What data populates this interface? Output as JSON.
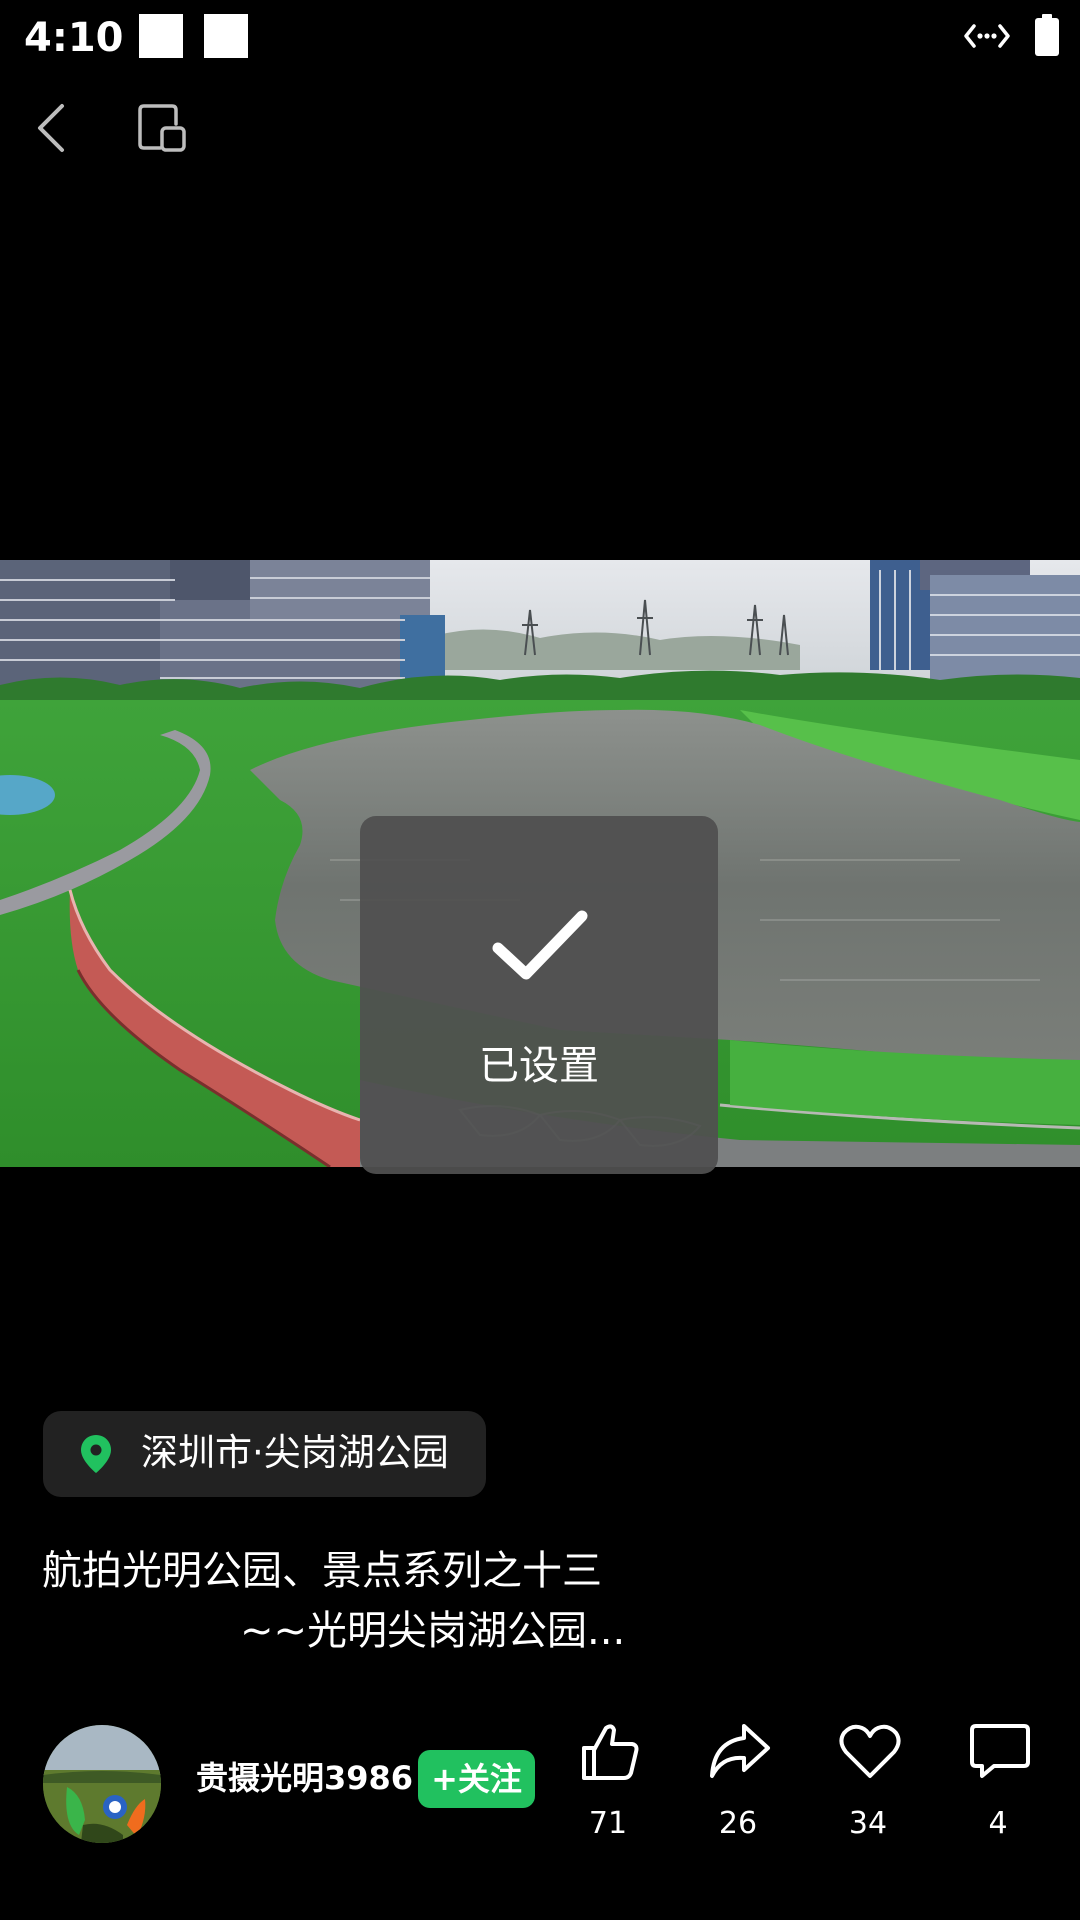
{
  "status_bar": {
    "time": "4:10"
  },
  "icons": {
    "back": "chevron-left-icon",
    "float_window": "floating-window-icon",
    "check": "check-icon",
    "location": "location-pin-icon",
    "like": "thumb-up-icon",
    "share": "share-arrow-icon",
    "favorite": "heart-icon",
    "comment": "comment-bubble-icon"
  },
  "toast": {
    "text": "已设置"
  },
  "location": {
    "label": "深圳市·尖岗湖公园"
  },
  "caption": {
    "line1": "航拍光明公园、景点系列之十三",
    "line2": "~~光明尖岗湖公园..."
  },
  "author": {
    "name": "贵摄光明3986",
    "follow_label": "+关注"
  },
  "actions": {
    "likes": "71",
    "shares": "26",
    "favorites": "34",
    "comments": "4"
  },
  "colors": {
    "accent": "#21c15f",
    "background": "#000000",
    "toast": "#505050"
  }
}
